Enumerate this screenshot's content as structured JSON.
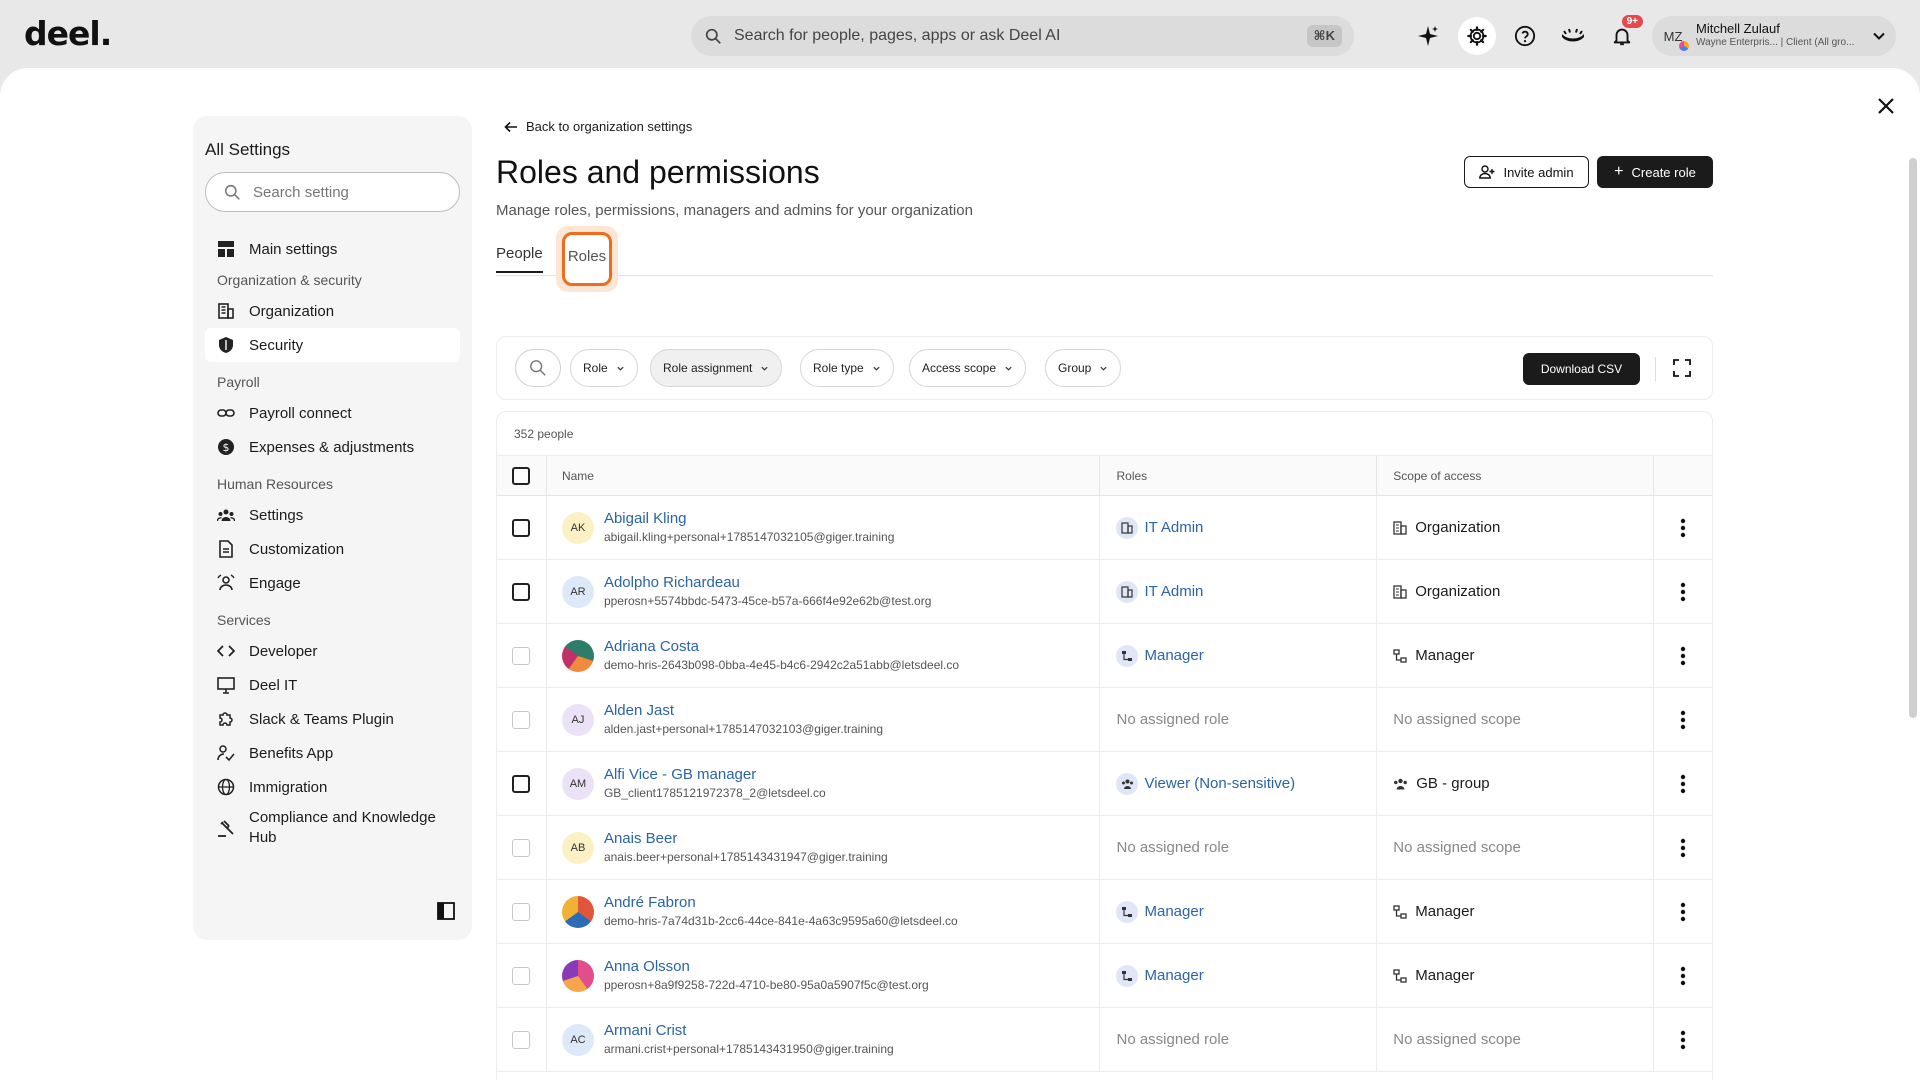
{
  "brand": {
    "logo": "deel."
  },
  "topbar": {
    "search_placeholder": "Search for people, pages, apps or ask Deel AI",
    "shortcut": "⌘K",
    "notifications_badge": "9+",
    "user": {
      "initials": "MZ",
      "name": "Mitchell Zulauf",
      "subtitle": "Wayne Enterpris... | Client (All gro..."
    }
  },
  "sidebar": {
    "title": "All Settings",
    "search_placeholder": "Search setting",
    "main_settings": "Main settings",
    "sections": {
      "org_security": "Organization & security",
      "payroll": "Payroll",
      "hr": "Human Resources",
      "services": "Services"
    },
    "items": {
      "organization": "Organization",
      "security": "Security",
      "payroll_connect": "Payroll connect",
      "expenses": "Expenses & adjustments",
      "settings": "Settings",
      "customization": "Customization",
      "engage": "Engage",
      "developer": "Developer",
      "deel_it": "Deel IT",
      "slack": "Slack & Teams Plugin",
      "benefits": "Benefits App",
      "immigration": "Immigration",
      "compliance": "Compliance and Knowledge Hub"
    }
  },
  "main": {
    "back_label": "Back to organization settings",
    "title": "Roles and permissions",
    "subtitle": "Manage roles, permissions, managers and admins for your organization",
    "invite_admin": "Invite admin",
    "create_role": "Create role",
    "tabs": {
      "people": "People",
      "roles": "Roles"
    },
    "filters": {
      "role": "Role",
      "role_assignment": "Role assignment",
      "role_type": "Role type",
      "access_scope": "Access scope",
      "group": "Group",
      "download": "Download CSV"
    },
    "table": {
      "count": "352 people",
      "headers": {
        "name": "Name",
        "roles": "Roles",
        "scope": "Scope of access"
      },
      "rows": [
        {
          "initials": "AK",
          "name": "Abigail Kling",
          "email": "abigail.kling+personal+1785147032105@giger.training",
          "role": "IT Admin",
          "scope": "Organization"
        },
        {
          "initials": "AR",
          "name": "Adolpho Richardeau",
          "email": "pperosn+5574bbdc-5473-45ce-b57a-666f4e92e62b@test.org",
          "role": "IT Admin",
          "scope": "Organization"
        },
        {
          "initials": "",
          "name": "Adriana Costa",
          "email": "demo-hris-2643b098-0bba-4e45-b4c6-2942c2a51abb@letsdeel.co",
          "role": "Manager",
          "scope": "Manager"
        },
        {
          "initials": "AJ",
          "name": "Alden Jast",
          "email": "alden.jast+personal+1785147032103@giger.training",
          "role": "No assigned role",
          "scope": "No assigned scope"
        },
        {
          "initials": "AM",
          "name": "Alfi Vice - GB manager",
          "email": "GB_client1785121972378_2@letsdeel.co",
          "role": "Viewer (Non-sensitive)",
          "scope": "GB - group"
        },
        {
          "initials": "AB",
          "name": "Anais Beer",
          "email": "anais.beer+personal+1785143431947@giger.training",
          "role": "No assigned role",
          "scope": "No assigned scope"
        },
        {
          "initials": "",
          "name": "André Fabron",
          "email": "demo-hris-7a74d31b-2cc6-44ce-841e-4a63c9595a60@letsdeel.co",
          "role": "Manager",
          "scope": "Manager"
        },
        {
          "initials": "",
          "name": "Anna Olsson",
          "email": "pperosn+8a9f9258-722d-4710-be80-95a0a5907f5c@test.org",
          "role": "Manager",
          "scope": "Manager"
        },
        {
          "initials": "AC",
          "name": "Armani Crist",
          "email": "armani.crist+personal+1785143431950@giger.training",
          "role": "No assigned role",
          "scope": "No assigned scope"
        }
      ]
    }
  }
}
